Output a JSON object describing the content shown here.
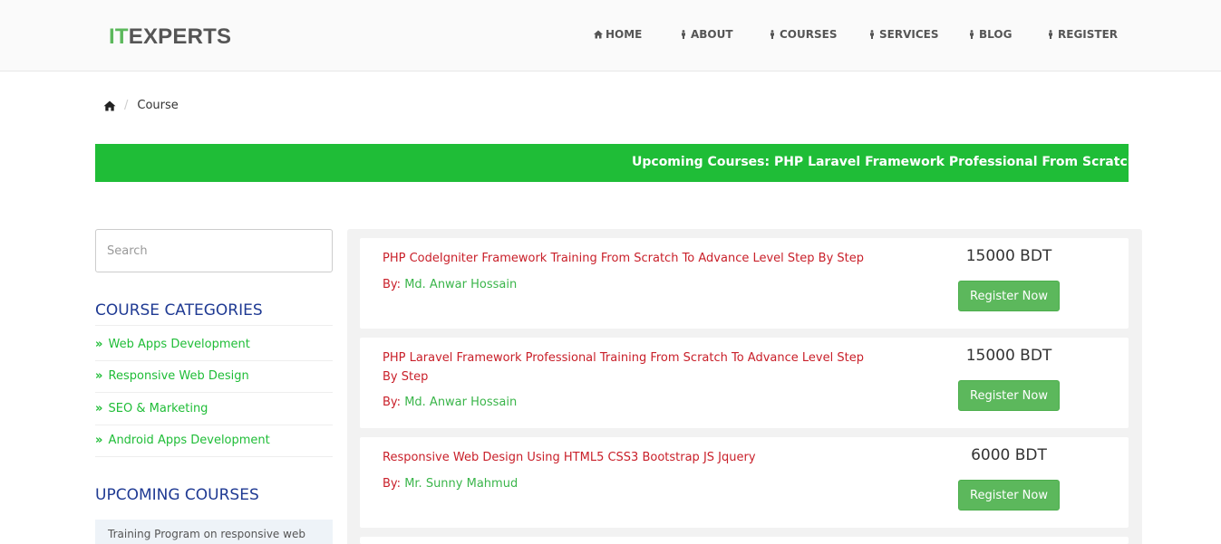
{
  "logo": {
    "part1": "IT",
    "part2": "EXPERTS"
  },
  "nav": [
    {
      "label": "HOME",
      "icon": "home-icon"
    },
    {
      "label": "ABOUT",
      "icon": "person-icon"
    },
    {
      "label": "COURSES",
      "icon": "person-icon"
    },
    {
      "label": "SERVICES",
      "icon": "person-icon"
    },
    {
      "label": "BLOG",
      "icon": "person-icon"
    },
    {
      "label": "REGISTER",
      "icon": "person-icon"
    }
  ],
  "breadcrumb": {
    "home_icon": "home-icon",
    "separator": "/",
    "current": "Course"
  },
  "marquee": {
    "text": "Upcoming Courses: PHP Laravel Framework Professional From Scratch to Adv"
  },
  "sidebar": {
    "search_placeholder": "Search",
    "categories_heading": "COURSE CATEGORIES",
    "categories": [
      {
        "label": "Web Apps Development"
      },
      {
        "label": "Responsive Web Design"
      },
      {
        "label": "SEO & Marketing"
      },
      {
        "label": "Android Apps Development"
      }
    ],
    "upcoming_heading": "UPCOMING COURSES",
    "upcoming_item": "Training Program on responsive web"
  },
  "courses": [
    {
      "title": "PHP CodeIgniter Framework Training From Scratch To Advance Level Step By Step",
      "by_label": "By:",
      "author": "Md. Anwar Hossain",
      "price": "15000 BDT",
      "button": "Register Now"
    },
    {
      "title": "PHP Laravel Framework Professional Training From Scratch To Advance Level Step By Step",
      "by_label": "By:",
      "author": "Md. Anwar Hossain",
      "price": "15000 BDT",
      "button": "Register Now"
    },
    {
      "title": "Responsive Web Design Using HTML5 CSS3 Bootstrap JS Jquery",
      "by_label": "By:",
      "author": "Mr. Sunny Mahmud",
      "price": "6000 BDT",
      "button": "Register Now"
    }
  ],
  "colors": {
    "accent_green": "#1fbd37",
    "button_green": "#5cb85c",
    "title_red": "#c9202a",
    "heading_blue": "#1f3a93"
  }
}
